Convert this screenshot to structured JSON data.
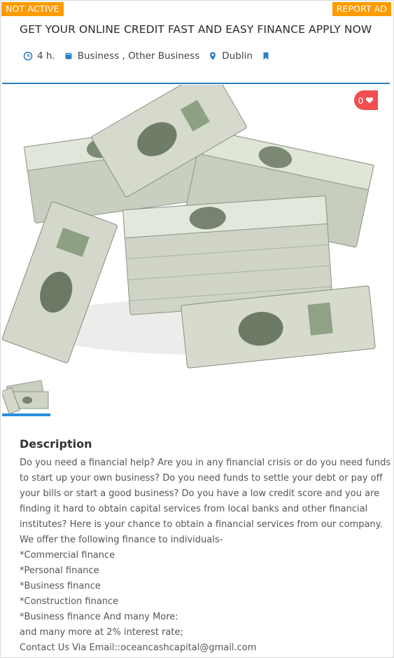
{
  "badges": {
    "status": "NOT ACTIVE",
    "report": "REPORT AD"
  },
  "listing": {
    "title": "GET YOUR ONLINE CREDIT FAST AND EASY FINANCE APPLY NOW",
    "time": "4 h.",
    "category": "Business , Other Business",
    "location": "Dublin",
    "likes": "0"
  },
  "description": {
    "heading": "Description",
    "lines": [
      "Do you need a financial help? Are you in any financial crisis or do you need funds",
      "to start up your own business? Do you need funds to settle your debt or pay off",
      "your bills or start a good business? Do you have a low credit score and you are",
      "finding it hard to obtain capital services from local banks and other financial",
      "institutes? Here is your chance to obtain a financial services from our company.",
      "We offer the following finance to individuals-",
      "*Commercial finance",
      "*Personal finance",
      "*Business finance",
      "*Construction finance",
      "*Business finance And many More:",
      "and many more at 2% interest rate;",
      "Contact Us Via Email::oceancashcapital@gmail.com"
    ]
  },
  "colors": {
    "badge": "#ff9b00",
    "accent": "#2c7fc2",
    "like": "#f04f4f",
    "thumb_active": "#2a8fe0"
  },
  "icons": [
    "clock-icon",
    "book-icon",
    "map-marker-icon",
    "bookmark-icon",
    "heart-icon"
  ]
}
